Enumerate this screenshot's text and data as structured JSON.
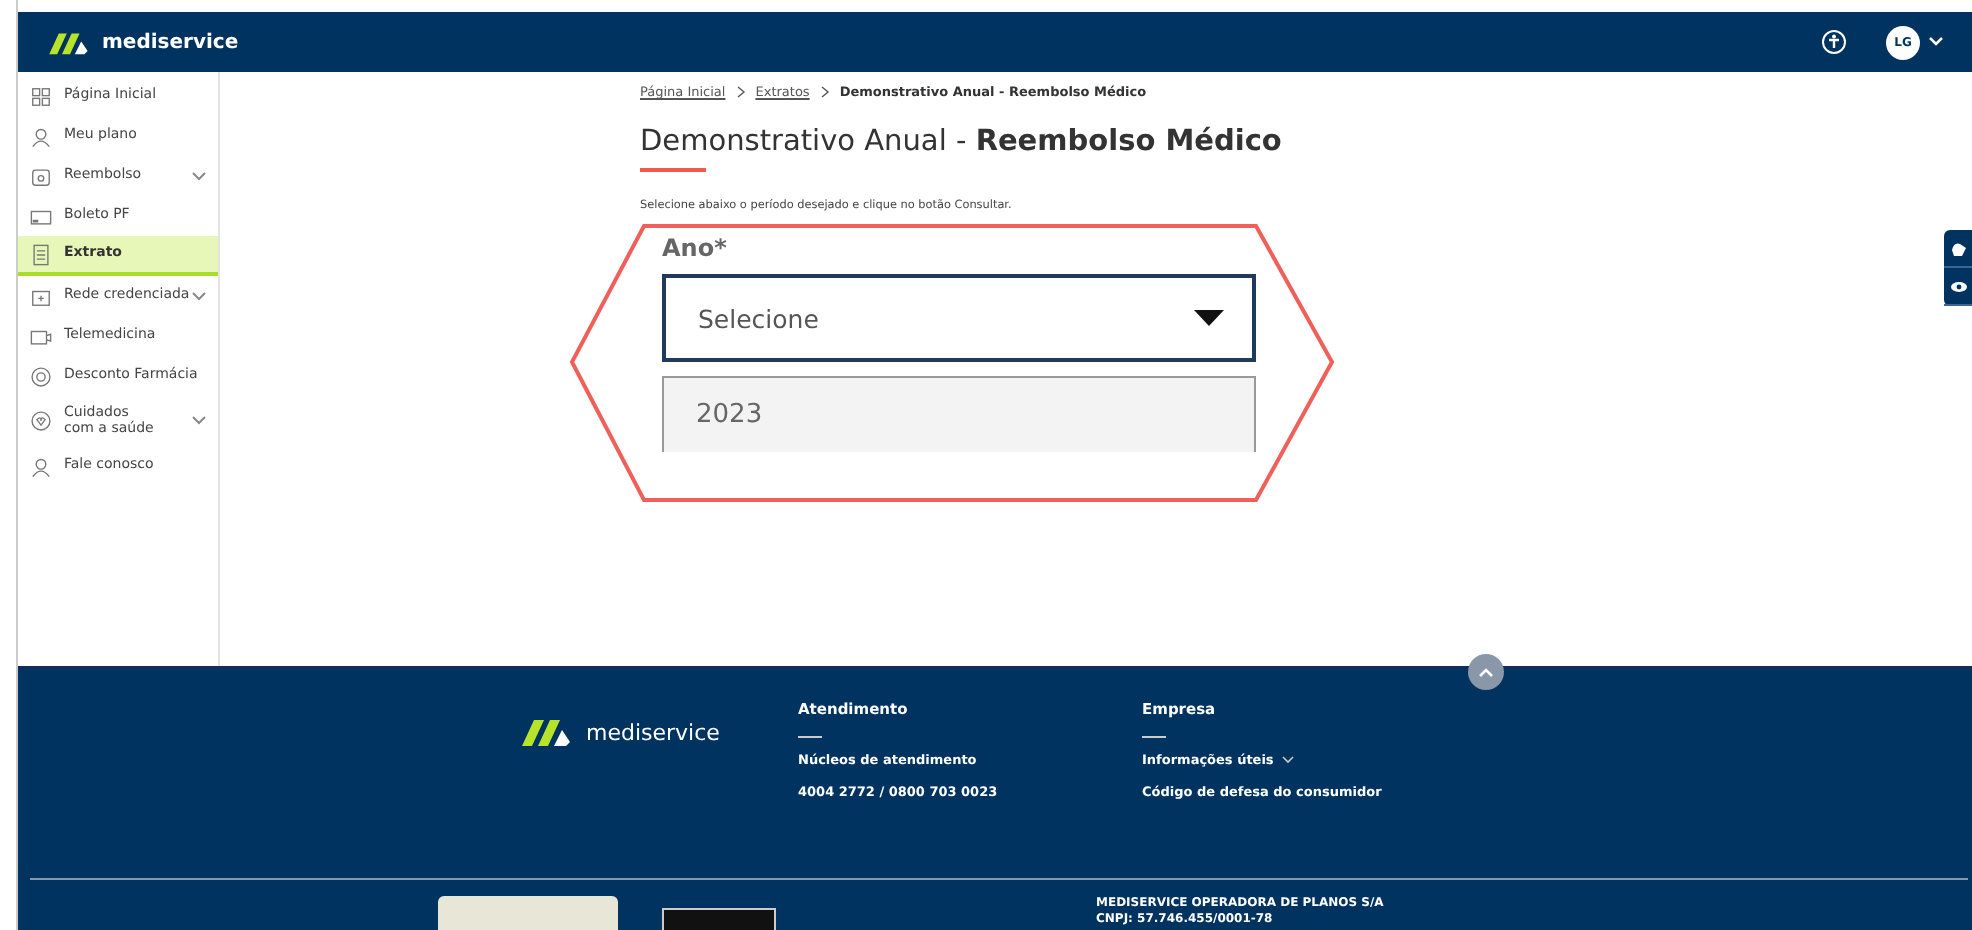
{
  "header": {
    "brand": "mediservice",
    "avatar": "LG"
  },
  "sidebar": {
    "items": [
      {
        "label": "Página Inicial",
        "kind": "grid",
        "expandable": false,
        "selected": false
      },
      {
        "label": "Meu plano",
        "kind": "person",
        "expandable": false,
        "selected": false
      },
      {
        "label": "Reembolso",
        "kind": "wallet",
        "expandable": true,
        "selected": false
      },
      {
        "label": "Boleto PF",
        "kind": "doc",
        "expandable": false,
        "selected": false
      },
      {
        "label": "Extrato",
        "kind": "list",
        "expandable": false,
        "selected": true
      },
      {
        "label": "Rede credenciada",
        "kind": "building",
        "expandable": true,
        "selected": false
      },
      {
        "label": "Telemedicina",
        "kind": "video",
        "expandable": false,
        "selected": false
      },
      {
        "label": "Desconto Farmácia",
        "kind": "circle",
        "expandable": false,
        "selected": false
      },
      {
        "label": "Cuidados\ncom a saúde",
        "kind": "heart",
        "expandable": true,
        "selected": false
      },
      {
        "label": "Fale conosco",
        "kind": "person",
        "expandable": false,
        "selected": false
      }
    ]
  },
  "breadcrumb": [
    {
      "label": "Página Inicial",
      "link": true
    },
    {
      "label": "Extratos",
      "link": true
    },
    {
      "label": "Demonstrativo Anual - Reembolso Médico",
      "link": false
    }
  ],
  "page_title": "Demonstrativo Anual - **Reembolso Médico**",
  "instruction": "Selecione abaixo o período desejado e clique no botão Consultar.",
  "year_field": {
    "label": "Ano*",
    "placeholder": "Selecione",
    "expanded": true,
    "options": [
      "2023"
    ]
  },
  "footer": {
    "brand": "mediservice",
    "columns": [
      {
        "heading": "Atendimento",
        "lines": [
          {
            "text": "Núcleos de atendimento",
            "dropdown": false
          },
          {
            "text": "4004 2772 / 0800 703 0023",
            "dropdown": false
          }
        ]
      },
      {
        "heading": "Empresa",
        "lines": [
          {
            "text": "Informações úteis",
            "dropdown": true
          },
          {
            "text": "Código de defesa do consumidor",
            "dropdown": false
          }
        ]
      }
    ],
    "company": [
      "MEDISERVICE OPERADORA DE PLANOS S/A",
      "CNPJ: 57.746.455/0001-78"
    ]
  }
}
